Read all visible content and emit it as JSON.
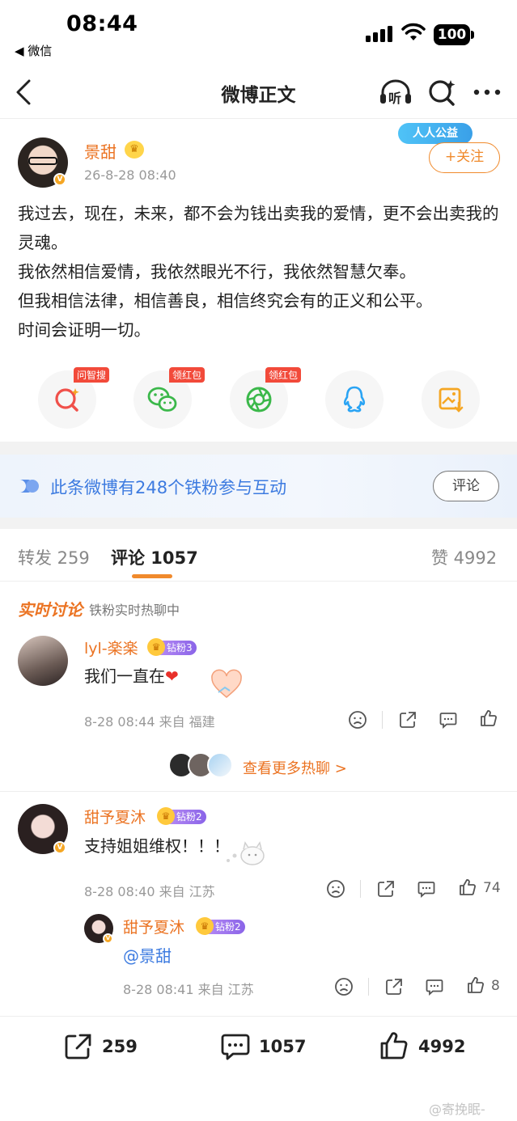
{
  "status_bar": {
    "time": "08:44",
    "back_app": "◀ 微信",
    "battery": "100"
  },
  "nav": {
    "title": "微博正文",
    "listen_label": "听"
  },
  "post": {
    "author": "景甜",
    "time": "26-8-28 08:40",
    "charity_badge": "人人公益",
    "follow_label": "+关注",
    "lines": [
      "我过去，现在，未来，都不会为钱出卖我的爱情，更不会出卖我的灵魂。",
      "我依然相信爱情，我依然眼光不行，我依然智慧欠奉。",
      "但我相信法律，相信善良，相信终究会有的正义和公平。",
      "时间会证明一切。"
    ]
  },
  "share_row": [
    {
      "icon": "ai-search-icon",
      "tag": "问智搜",
      "color": "#f0504a"
    },
    {
      "icon": "wechat-icon",
      "tag": "领红包",
      "color": "#3bb84a"
    },
    {
      "icon": "moments-icon",
      "tag": "领红包",
      "color": "#3bb84a"
    },
    {
      "icon": "qq-icon",
      "tag": "",
      "color": "#2aa4f4"
    },
    {
      "icon": "save-image-icon",
      "tag": "",
      "color": "#f5a623"
    }
  ],
  "fans_bar": {
    "text": "此条微博有248个铁粉参与互动",
    "button": "评论"
  },
  "tabs": {
    "repost": "转发 259",
    "comments": "评论 1057",
    "likes": "赞 4992"
  },
  "live": {
    "title": "实时讨论",
    "subtitle": "铁粉实时热聊中"
  },
  "comments": [
    {
      "name": "lyl-楽楽",
      "badge": "钻粉3",
      "text": "我们一直在",
      "meta": "8-28 08:44 来自 福建",
      "likes": ""
    },
    {
      "name": "甜予夏沐",
      "badge": "钻粉2",
      "text": "支持姐姐维权！！！",
      "meta": "8-28 08:40 来自 江苏",
      "likes": "74"
    }
  ],
  "more_chat": "查看更多热聊 >",
  "reply": {
    "name": "甜予夏沐",
    "badge": "钻粉2",
    "text": "@景甜",
    "meta": "8-28 08:41 来自 江苏",
    "likes": "8"
  },
  "bottom_bar": {
    "reposts": "259",
    "comments": "1057",
    "likes": "4992"
  },
  "watermark": "@寄挽眠-",
  "colors": {
    "accent": "#eb7322",
    "link": "#3d7be0",
    "follow": "#f08a2c"
  }
}
